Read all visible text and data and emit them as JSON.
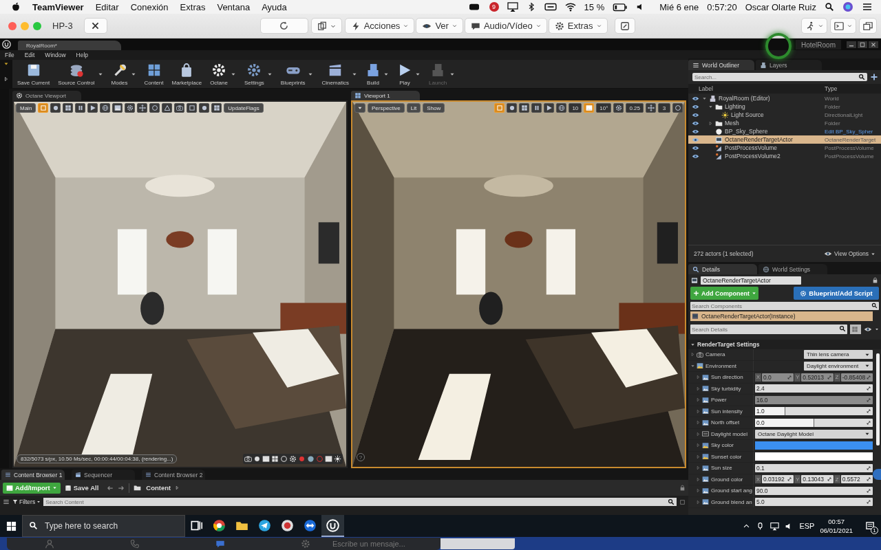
{
  "mac_menubar": {
    "app": "TeamViewer",
    "menus": [
      "Editar",
      "Conexión",
      "Extras",
      "Ventana",
      "Ayuda"
    ],
    "badge": "9",
    "battery": "15 %",
    "date": "Mié 6 ene",
    "time": "0:57:20",
    "user": "Oscar Olarte Ruiz"
  },
  "teamviewer_toolbar": {
    "title": "HP-3",
    "menus": [
      {
        "label": "Acciones"
      },
      {
        "label": "Ver"
      },
      {
        "label": "Audio/Vídeo"
      },
      {
        "label": "Extras"
      }
    ]
  },
  "editor": {
    "document_tabs": [
      {
        "label": "RoyalRoom*",
        "selected": true
      }
    ],
    "project": "HotelRoom",
    "menu": [
      "File",
      "Edit",
      "Window",
      "Help"
    ],
    "toolbar": [
      {
        "label": "Save Current",
        "dropdown": false,
        "disabled": false
      },
      {
        "label": "Source Control",
        "dropdown": true,
        "disabled": false
      },
      {
        "label": "Modes",
        "dropdown": true,
        "disabled": false
      },
      {
        "label": "Content",
        "dropdown": false,
        "disabled": false
      },
      {
        "label": "Marketplace",
        "dropdown": false,
        "disabled": false
      },
      {
        "label": "Octane",
        "dropdown": true,
        "disabled": false
      },
      {
        "label": "Settings",
        "dropdown": true,
        "disabled": false
      },
      {
        "label": "Blueprints",
        "dropdown": true,
        "disabled": false
      },
      {
        "label": "Cinematics",
        "dropdown": true,
        "disabled": false
      },
      {
        "label": "Build",
        "dropdown": true,
        "disabled": false
      },
      {
        "label": "Play",
        "dropdown": true,
        "disabled": false
      },
      {
        "label": "Launch",
        "dropdown": true,
        "disabled": true
      }
    ],
    "viewports": [
      {
        "tab": "Octane Viewport",
        "selected": false,
        "toolbar": [
          {
            "kind": "button",
            "label": "Main"
          },
          {
            "kind": "icon",
            "selected": true
          },
          {
            "kind": "icon",
            "selected": false
          },
          {
            "kind": "icon",
            "selected": false
          },
          {
            "kind": "icon",
            "selected": false
          },
          {
            "kind": "icon",
            "selected": false
          },
          {
            "kind": "icon",
            "selected": false
          },
          {
            "kind": "icon",
            "selected": false
          },
          {
            "kind": "icon",
            "selected": false
          },
          {
            "kind": "icon",
            "selected": false
          },
          {
            "kind": "icon",
            "selected": false
          },
          {
            "kind": "icon",
            "selected": false
          },
          {
            "kind": "icon",
            "selected": false
          },
          {
            "kind": "icon",
            "selected": false
          },
          {
            "kind": "icon",
            "selected": false
          },
          {
            "kind": "icon",
            "selected": false
          },
          {
            "kind": "button",
            "label": "UpdateFlags"
          }
        ],
        "status": "832/5073 s/px, 10.50 Ms/sec, 00:00:44/00:04:38, (rendering...)"
      },
      {
        "tab": "Viewport 1",
        "selected": true,
        "toolbar": [
          {
            "kind": "menu"
          },
          {
            "kind": "button",
            "label": "Perspective"
          },
          {
            "kind": "button",
            "label": "Lit"
          },
          {
            "kind": "button",
            "label": "Show"
          },
          {
            "kind": "spacer"
          },
          {
            "kind": "icon",
            "selected": true
          },
          {
            "kind": "icon",
            "selected": false
          },
          {
            "kind": "icon",
            "selected": false
          },
          {
            "kind": "icon",
            "selected": false
          },
          {
            "kind": "icon",
            "selected": false
          },
          {
            "kind": "icon",
            "selected": false
          },
          {
            "kind": "value",
            "label": "10"
          },
          {
            "kind": "icon",
            "selected": true
          },
          {
            "kind": "value",
            "label": "10°"
          },
          {
            "kind": "icon",
            "selected": false
          },
          {
            "kind": "value",
            "label": "0.25"
          },
          {
            "kind": "icon",
            "selected": false
          },
          {
            "kind": "value",
            "label": "3"
          },
          {
            "kind": "icon",
            "selected": false
          }
        ],
        "help": "?"
      }
    ],
    "world_outliner": {
      "tabs": [
        {
          "label": "World Outliner",
          "selected": true
        },
        {
          "label": "Layers",
          "selected": false
        }
      ],
      "search": {
        "placeholder": "Search..."
      },
      "columns": [
        "Label",
        "Type"
      ],
      "rows": [
        {
          "label": "RoyalRoom (Editor)",
          "type": "World",
          "kind": "world",
          "visible": true,
          "expanded": true,
          "selected": false,
          "type_link": false,
          "children": [
            {
              "label": "Lighting",
              "type": "Folder",
              "kind": "folder",
              "visible": true,
              "expanded": true,
              "selected": false,
              "type_link": false,
              "children": [
                {
                  "label": "Light Source",
                  "type": "DirectionalLight",
                  "kind": "light",
                  "visible": true,
                  "selected": false,
                  "type_link": false
                }
              ]
            },
            {
              "label": "Mesh",
              "type": "Folder",
              "kind": "folder",
              "visible": true,
              "expanded": false,
              "selected": false,
              "type_link": false
            },
            {
              "label": "BP_Sky_Sphere",
              "type": "Edit BP_Sky_Spher",
              "kind": "sphere",
              "visible": true,
              "selected": false,
              "type_link": true
            },
            {
              "label": "OctaneRenderTargetActor",
              "type": "OctaneRenderTarget",
              "kind": "actor",
              "visible": true,
              "selected": true,
              "type_link": false
            },
            {
              "label": "PostProcessVolume",
              "type": "PostProcessVolume",
              "kind": "volume",
              "visible": true,
              "selected": false,
              "type_link": false
            },
            {
              "label": "PostProcessVolume2",
              "type": "PostProcessVolume",
              "kind": "volume",
              "visible": true,
              "selected": false,
              "type_link": false
            }
          ]
        }
      ],
      "footer": "272 actors (1 selected)",
      "view_options": "View Options"
    },
    "details": {
      "tabs": [
        {
          "label": "Details",
          "selected": true
        },
        {
          "label": "World Settings",
          "selected": false
        }
      ],
      "name": "OctaneRenderTargetActor",
      "add_component": "Add Component",
      "blueprint": "Blueprint/Add Script",
      "search_components": {
        "placeholder": "Search Components"
      },
      "components": [
        {
          "label": "OctaneRenderTargetActor(Instance)",
          "selected": true
        }
      ],
      "search_details": {
        "placeholder": "Search Details"
      },
      "section": {
        "label": "RenderTarget Settings",
        "expanded": true
      },
      "properties": [
        {
          "label": "Camera",
          "kind": "dropdown",
          "value": "Thin lens camera",
          "expanded": false
        },
        {
          "label": "Environment",
          "kind": "dropdown",
          "value": "Daylight environment",
          "expanded": true,
          "children": [
            {
              "label": "Sun direction",
              "kind": "vector",
              "expanded": false,
              "disabled": true,
              "values": [
                {
                  "axis": "X",
                  "value": "0.0"
                },
                {
                  "axis": "Y",
                  "value": "0.52013"
                },
                {
                  "axis": "Z",
                  "value": "-0.85408"
                }
              ]
            },
            {
              "label": "Sky turbidity",
              "kind": "number",
              "expanded": false,
              "disabled": false,
              "value": "2.4"
            },
            {
              "label": "Power",
              "kind": "number",
              "expanded": false,
              "disabled": true,
              "value": "16.0"
            },
            {
              "label": "Sun intensity",
              "kind": "number",
              "expanded": false,
              "disabled": false,
              "value": "1.0",
              "level": 0.26
            },
            {
              "label": "North offset",
              "kind": "number",
              "expanded": false,
              "disabled": false,
              "value": "0.0",
              "level": 0.5
            },
            {
              "label": "Daylight model",
              "kind": "dropdown",
              "expanded": false,
              "value": "Octane Daylight Model"
            },
            {
              "label": "Sky color",
              "kind": "color",
              "expanded": false,
              "color": "#3b8ff0"
            },
            {
              "label": "Sunset color",
              "kind": "color",
              "expanded": false,
              "color": "#ffffff"
            },
            {
              "label": "Sun size",
              "kind": "number",
              "expanded": false,
              "disabled": false,
              "value": "0.1"
            },
            {
              "label": "Ground color",
              "kind": "vector",
              "expanded": false,
              "disabled": false,
              "values": [
                {
                  "axis": "X",
                  "value": "0.03192"
                },
                {
                  "axis": "Y",
                  "value": "0.13043"
                },
                {
                  "axis": "Z",
                  "value": "0.5572"
                }
              ]
            },
            {
              "label": "Ground start ang",
              "kind": "number",
              "expanded": false,
              "disabled": false,
              "value": "90.0"
            },
            {
              "label": "Ground blend an",
              "kind": "number",
              "expanded": false,
              "disabled": false,
              "value": "5.0"
            }
          ]
        }
      ]
    },
    "content_browser": {
      "tabs": [
        {
          "label": "Content Browser 1",
          "selected": true
        },
        {
          "label": "Sequencer",
          "selected": false
        },
        {
          "label": "Content Browser 2",
          "selected": false
        }
      ],
      "add_import": "Add/Import",
      "save_all": "Save All",
      "path": "Content",
      "filters": "Filters",
      "search": {
        "placeholder": "Search Content"
      }
    }
  },
  "taskbar": {
    "search": {
      "placeholder": "Type here to search"
    },
    "apps": [
      {
        "selected": false
      },
      {
        "selected": false
      },
      {
        "selected": false
      },
      {
        "selected": false
      },
      {
        "selected": false
      },
      {
        "selected": false
      },
      {
        "selected": true
      }
    ],
    "language": "ESP",
    "time": "00:57",
    "date": "06/01/2021",
    "notifications": "1"
  },
  "chat": {
    "placeholder": "Escribe un mensaje..."
  }
}
